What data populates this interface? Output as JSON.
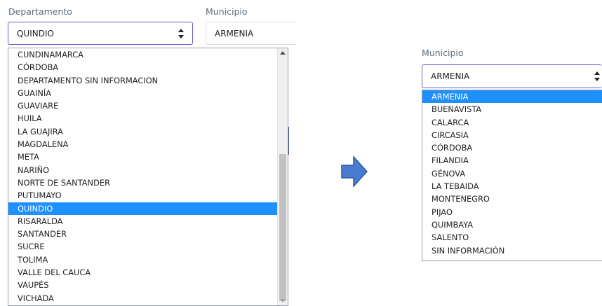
{
  "left": {
    "departamento_label": "Departamento",
    "departamento_value": "QUINDIO",
    "municipio_label": "Municipio",
    "municipio_value": "ARMENIA",
    "dropdown_options": [
      "CUNDINAMARCA",
      "CÓRDOBA",
      "DEPARTAMENTO SIN INFORMACION",
      "GUAINÍA",
      "GUAVIARE",
      "HUILA",
      "LA GUAJIRA",
      "MAGDALENA",
      "META",
      "NARIÑO",
      "NORTE DE SANTANDER",
      "PUTUMAYO",
      "QUINDIO",
      "RISARALDA",
      "SANTANDER",
      "SUCRE",
      "TOLIMA",
      "VALLE DEL CAUCA",
      "VAUPÉS",
      "VICHADA"
    ],
    "selected_option": "QUINDIO"
  },
  "right": {
    "municipio_label": "Municipio",
    "municipio_value": "ARMENIA",
    "dropdown_options": [
      "ARMENIA",
      "BUENAVISTA",
      "CALARCA",
      "CIRCASIA",
      "CÓRDOBA",
      "FILANDIA",
      "GÉNOVA",
      "LA TEBAIDA",
      "MONTENEGRO",
      "PIJAO",
      "QUIMBAYA",
      "SALENTO",
      "SIN INFORMACIÓN"
    ],
    "selected_option": "ARMENIA"
  },
  "colors": {
    "accent_border": "#6a5ad0",
    "selected_bg": "#1e90ff",
    "arrow_fill": "#4a7bd0"
  },
  "icons": {
    "select_caret": "updown-caret-icon",
    "transition": "right-arrow-icon"
  }
}
